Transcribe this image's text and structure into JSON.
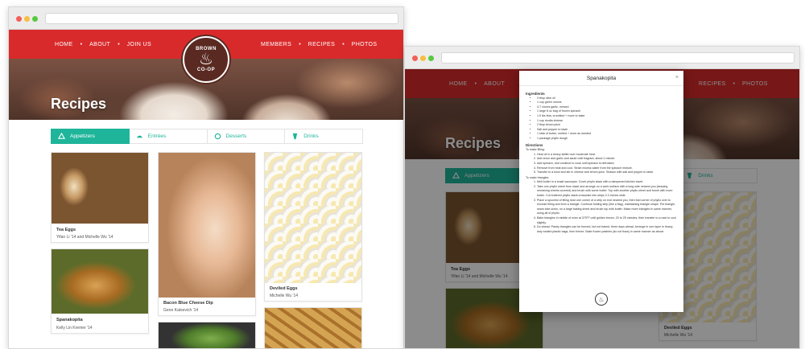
{
  "site": {
    "logo_top": "BROWN",
    "logo_bottom": "CO-OP",
    "nav_left": [
      "HOME",
      "ABOUT",
      "JOIN US"
    ],
    "nav_right": [
      "MEMBERS",
      "RECIPES",
      "PHOTOS"
    ],
    "hero_title": "Recipes",
    "tabs": [
      {
        "label": "Appetizers",
        "icon": "appetizer-icon",
        "active": true
      },
      {
        "label": "Entrées",
        "icon": "entree-icon",
        "active": false
      },
      {
        "label": "Desserts",
        "icon": "dessert-icon",
        "active": false
      },
      {
        "label": "Drinks",
        "icon": "drink-icon",
        "active": false
      }
    ],
    "cards": [
      {
        "title": "Tea Eggs",
        "author": "Yifan Li '14 and Michelle Wu '14"
      },
      {
        "title": "Spanakopita",
        "author": "Kelly Lin Kremer '14"
      },
      {
        "title": "Bacon Blue Cheese Dip",
        "author": "Gene Katsevich '14"
      },
      {
        "title": "Deviled Eggs",
        "author": "Michelle Wu '14"
      }
    ]
  },
  "modal": {
    "title": "Spanakopita",
    "ingredients_heading": "Ingredients",
    "ingredients": [
      "3 tbsp olive oil",
      "1 cup green onions",
      "4-7 cloves garlic, minced",
      "1 large 8 oz bag of frozen spinach",
      "1.5 lbs feta, crumbled + more to taste",
      "1 cup ricotta cheese",
      "2 tbsp lemon juice",
      "Salt and pepper to taste",
      "1 stick of butter, melted + more as needed",
      "1 package phyllo dough"
    ],
    "directions_heading": "Directions",
    "filling_heading": "To make filling:",
    "filling_steps": [
      "Heat oil in a heavy skillet over moderate heat.",
      "Add onion and garlic and saute until fragrant, about 1 minute.",
      "Add spinach, and continue to cook until spinach is defrosted.",
      "Remove from heat and cool. Strain excess water from the spinach mixture.",
      "Transfer to a bowl and stir in cheese and lemon juice. Season with salt and pepper to taste."
    ],
    "triangles_heading": "To make triangles:",
    "triangle_steps": [
      "Melt butter in a small saucepan. Cover phyllo stack with a dampened kitchen towel.",
      "Take one phyllo sheet from stack and arrange on a work surface with a long side nearest you (keeping remaining sheets covered) and brush with some butter. Top with another phyllo sheet and brush with more butter. Cut buttered phyllo stack crosswise into strips 2-3 inches wide.",
      "Place a spoonful of filling near one corner of a strip on end nearest you, then fold corner of phyllo over to enclose filling and form a triangle. Continue folding strip (like a flag), maintaining triangle shape. Put triangle, seam side down, on a large baking sheet and brush top with butter. Make more triangles in same manner, using all of phyllo.",
      "Bake triangles in middle of oven at 375°F until golden brown, 20 to 25 minutes, then transfer to a rack to cool slightly.",
      "Do ahead: Pastry triangles can be formed, but not baked, three days ahead. Arrange in one layer in heavy-duty sealed plastic bags, then freeze. Bake frozen pastries (do not thaw) in same manner as above."
    ]
  },
  "colors": {
    "nav_red": "#d92a2b",
    "accent_teal": "#1fb59a",
    "logo_brown": "#5a2a22"
  }
}
